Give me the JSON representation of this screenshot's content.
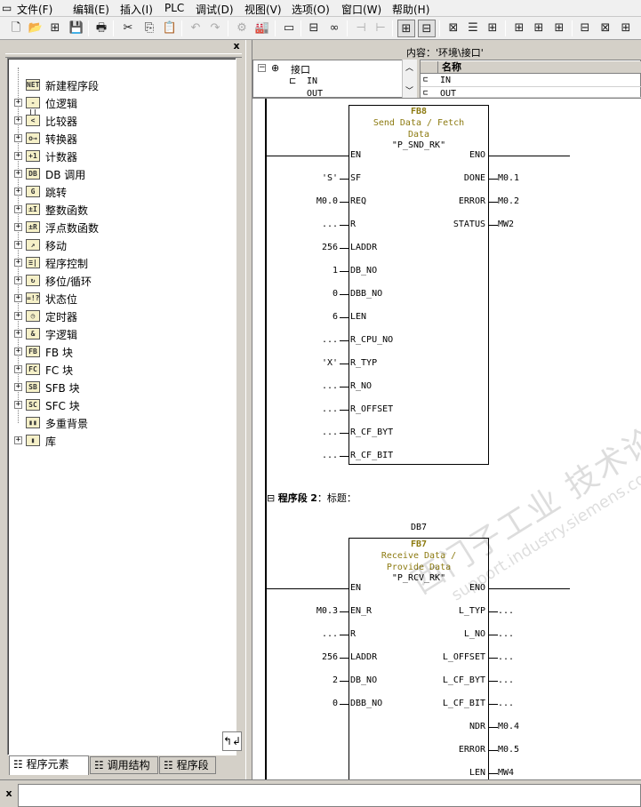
{
  "menu": [
    "文件(F)",
    "编辑(E)",
    "插入(I)",
    "PLC",
    "调试(D)",
    "视图(V)",
    "选项(O)",
    "窗口(W)",
    "帮助(H)"
  ],
  "toolbar_glyphs": [
    "🗋",
    "📂",
    "⊞",
    "💾",
    "🖶",
    "✂",
    "⎘",
    "📋",
    "↶",
    "↷",
    "⚙",
    "🏭",
    "▭",
    "⊟",
    "∞",
    "⊣",
    "⊢",
    "⊞",
    "⊟",
    "⊠",
    "☰",
    "⊞",
    "⊞",
    "⊞",
    "⊞",
    "⊟",
    "⊠"
  ],
  "left_panel": {
    "close": "x",
    "tree": [
      {
        "label": "新建程序段",
        "icon": "NET",
        "expand": ""
      },
      {
        "label": "位逻辑",
        "icon": "-||",
        "expand": "+"
      },
      {
        "label": "比较器",
        "icon": "<",
        "expand": "+"
      },
      {
        "label": "转换器",
        "icon": "o→",
        "expand": "+"
      },
      {
        "label": "计数器",
        "icon": "+1",
        "expand": "+"
      },
      {
        "label": "DB 调用",
        "icon": "DB",
        "expand": "+"
      },
      {
        "label": "跳转",
        "icon": "G",
        "expand": "+"
      },
      {
        "label": "整数函数",
        "icon": "±I",
        "expand": "+"
      },
      {
        "label": "浮点数函数",
        "icon": "±R",
        "expand": "+"
      },
      {
        "label": "移动",
        "icon": "↗",
        "expand": "+"
      },
      {
        "label": "程序控制",
        "icon": "≡|",
        "expand": "+"
      },
      {
        "label": "移位/循环",
        "icon": "↻",
        "expand": "+"
      },
      {
        "label": "状态位",
        "icon": "=!?",
        "expand": "+"
      },
      {
        "label": "定时器",
        "icon": "◷",
        "expand": "+"
      },
      {
        "label": "字逻辑",
        "icon": "&",
        "expand": "+"
      },
      {
        "label": "FB 块",
        "icon": "FB",
        "expand": "+"
      },
      {
        "label": "FC 块",
        "icon": "FC",
        "expand": "+"
      },
      {
        "label": "SFB 块",
        "icon": "SB",
        "expand": "+"
      },
      {
        "label": "SFC 块",
        "icon": "SC",
        "expand": "+"
      },
      {
        "label": "多重背景",
        "icon": "▮▮",
        "expand": ""
      },
      {
        "label": "库",
        "icon": "▮",
        "expand": "+"
      }
    ],
    "bottom_icon": "↰↲",
    "tabs": [
      "程序元素",
      "调用结构",
      "程序段"
    ]
  },
  "interface": {
    "content_label": "内容：'环境\\接口'",
    "tree_root": "接口",
    "tree_items": [
      "IN",
      "OUT"
    ],
    "table_header": "名称",
    "table_rows": [
      "IN",
      "OUT"
    ]
  },
  "network1": {
    "block_type": "FB8",
    "block_title": "Send Data / Fetch Data",
    "block_name": "\"P_SND_RK\"",
    "left_pins": [
      {
        "pin": "EN",
        "actual": ""
      },
      {
        "pin": "SF",
        "actual": "'S'"
      },
      {
        "pin": "REQ",
        "actual": "M0.0"
      },
      {
        "pin": "R",
        "actual": "..."
      },
      {
        "pin": "LADDR",
        "actual": "256"
      },
      {
        "pin": "DB_NO",
        "actual": "1"
      },
      {
        "pin": "DBB_NO",
        "actual": "0"
      },
      {
        "pin": "LEN",
        "actual": "6"
      },
      {
        "pin": "R_CPU_NO",
        "actual": "..."
      },
      {
        "pin": "R_TYP",
        "actual": "'X'"
      },
      {
        "pin": "R_NO",
        "actual": "..."
      },
      {
        "pin": "R_OFFSET",
        "actual": "..."
      },
      {
        "pin": "R_CF_BYT",
        "actual": "..."
      },
      {
        "pin": "R_CF_BIT",
        "actual": "..."
      }
    ],
    "right_pins": [
      {
        "pin": "ENO",
        "actual": ""
      },
      {
        "pin": "DONE",
        "actual": "M0.1"
      },
      {
        "pin": "ERROR",
        "actual": "M0.2"
      },
      {
        "pin": "STATUS",
        "actual": "MW2"
      }
    ]
  },
  "network2": {
    "title_prefix": "程序段",
    "title_num": "2",
    "title_text": "：标题：",
    "instance_db": "DB7",
    "block_type": "FB7",
    "block_title": "Receive Data / Provide Data",
    "block_name": "\"P_RCV_RK\"",
    "left_pins": [
      {
        "pin": "EN",
        "actual": ""
      },
      {
        "pin": "EN_R",
        "actual": "M0.3"
      },
      {
        "pin": "R",
        "actual": "..."
      },
      {
        "pin": "LADDR",
        "actual": "256"
      },
      {
        "pin": "DB_NO",
        "actual": "2"
      },
      {
        "pin": "DBB_NO",
        "actual": "0"
      }
    ],
    "right_pins": [
      {
        "pin": "ENO",
        "actual": ""
      },
      {
        "pin": "L_TYP",
        "actual": "..."
      },
      {
        "pin": "L_NO",
        "actual": "..."
      },
      {
        "pin": "L_OFFSET",
        "actual": "..."
      },
      {
        "pin": "L_CF_BYT",
        "actual": "..."
      },
      {
        "pin": "L_CF_BIT",
        "actual": "..."
      },
      {
        "pin": "NDR",
        "actual": "M0.4"
      },
      {
        "pin": "ERROR",
        "actual": "M0.5"
      },
      {
        "pin": "LEN",
        "actual": "MW4"
      }
    ]
  },
  "watermark": {
    "line1": "西门子工业 技术论坛",
    "line2": "support.industry.siemens.com/cs"
  },
  "statusbar": {
    "close": "x"
  }
}
